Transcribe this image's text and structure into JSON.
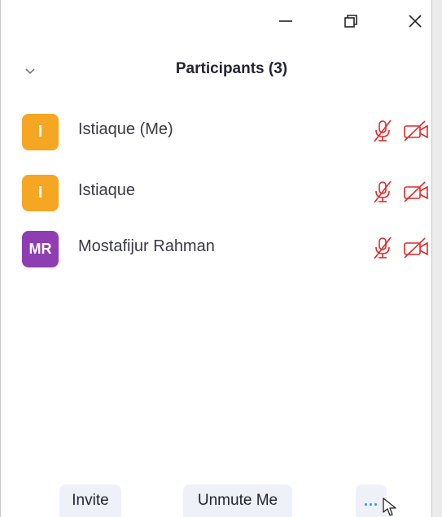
{
  "window": {
    "controls": {
      "minimize": "minimize-icon",
      "restore": "restore-icon",
      "close": "close-icon"
    }
  },
  "panel": {
    "title": "Participants (3)",
    "collapse_icon": "chevron-down-icon"
  },
  "participants": [
    {
      "initials": "I",
      "name": "Istiaque (Me)",
      "avatar_color": "#f5a623",
      "mic": "muted",
      "video": "off"
    },
    {
      "initials": "I",
      "name": "Istiaque",
      "avatar_color": "#f5a623",
      "mic": "muted",
      "video": "off"
    },
    {
      "initials": "MR",
      "name": "Mostafijur Rahman",
      "avatar_color": "#8e3db3",
      "mic": "muted",
      "video": "off"
    }
  ],
  "footer": {
    "invite_label": "Invite",
    "unmute_label": "Unmute Me",
    "more_label": "..."
  },
  "colors": {
    "muted_icon": "#e02828",
    "accent": "#2d8cff",
    "button_bg": "#eef1f7"
  }
}
